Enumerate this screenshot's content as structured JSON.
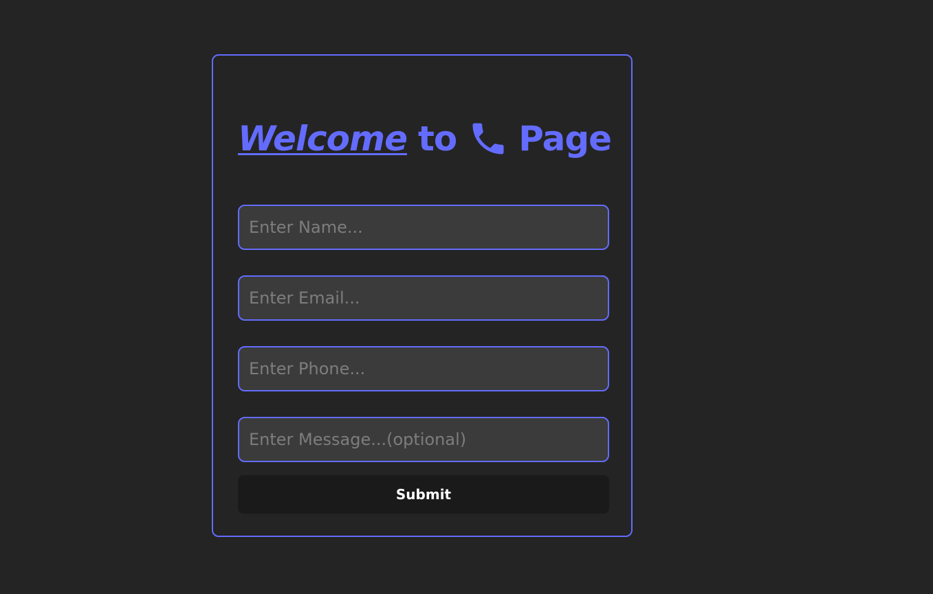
{
  "header": {
    "title_welcome": "Welcome",
    "title_to": "to",
    "title_icon": "phone-icon",
    "title_page": "Page"
  },
  "form": {
    "name": {
      "placeholder": "Enter Name...",
      "value": ""
    },
    "email": {
      "placeholder": "Enter Email...",
      "value": ""
    },
    "phone": {
      "placeholder": "Enter Phone...",
      "value": ""
    },
    "message": {
      "placeholder": "Enter Message...(optional)",
      "value": ""
    },
    "submit_label": "Submit"
  },
  "colors": {
    "accent": "#646cff",
    "background": "#242424",
    "field_background": "#3b3b3b",
    "button_background": "#1a1a1a",
    "button_text": "#ffffff"
  }
}
